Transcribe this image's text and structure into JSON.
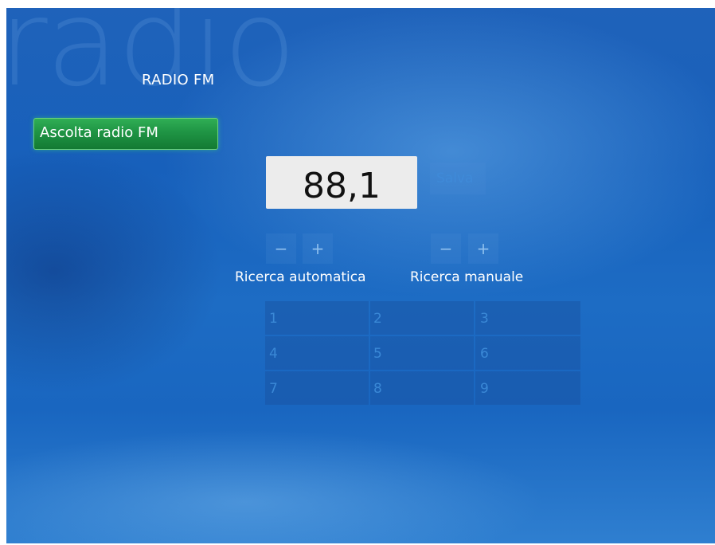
{
  "header": {
    "background_word": "radio",
    "title": "RADIO FM"
  },
  "menu": {
    "items": [
      {
        "label": "Ascolta radio FM",
        "selected": true
      }
    ]
  },
  "tuner": {
    "frequency": "88,1",
    "save_label": "Salva",
    "auto_search": {
      "label": "Ricerca automatica",
      "minus": "−",
      "plus": "+"
    },
    "manual_search": {
      "label": "Ricerca manuale",
      "minus": "−",
      "plus": "+"
    }
  },
  "keypad": {
    "keys": [
      "1",
      "2",
      "3",
      "4",
      "5",
      "6",
      "7",
      "8",
      "9"
    ]
  },
  "colors": {
    "background_blue": "#1760bb",
    "focus_green": "#1f9444",
    "display_bg": "#ececec",
    "dim_text": "#3a88d6"
  }
}
